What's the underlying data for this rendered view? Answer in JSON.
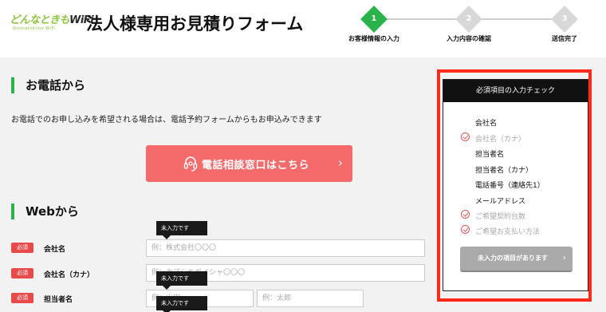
{
  "header": {
    "logo_main": "どんなときもWiFi",
    "logo_sub": "Donnatokimo WiFi",
    "title": "法人様専用お見積りフォーム",
    "steps": [
      {
        "num": "1",
        "label": "お客様情報の入力",
        "active": true
      },
      {
        "num": "2",
        "label": "入力内容の確認",
        "active": false
      },
      {
        "num": "3",
        "label": "送信完了",
        "active": false
      }
    ]
  },
  "phone_section": {
    "heading": "お電話から",
    "description": "お電話でのお申し込みを希望される場合は、電話予約フォームからもお申込みできます",
    "button_label": "電話相談窓口はこちら",
    "button_chevron": "›"
  },
  "web_section": {
    "heading": "Webから",
    "required_badge": "必須",
    "tooltip": "未入力です",
    "fields": [
      {
        "label": "会社名",
        "placeholder": "例：株式会社〇〇〇"
      },
      {
        "label": "会社名（カナ）",
        "placeholder": "例：カブシキガイシャ〇〇〇"
      },
      {
        "label": "担当者名",
        "placeholder_last": "例：山田",
        "placeholder_first": "例：太郎"
      }
    ]
  },
  "checklist": {
    "header": "必須項目の入力チェック",
    "items": [
      {
        "label": "会社名",
        "done": false
      },
      {
        "label": "会社名（カナ）",
        "done": true
      },
      {
        "label": "担当者名",
        "done": false
      },
      {
        "label": "担当者名（カナ）",
        "done": false
      },
      {
        "label": "電話番号（連絡先1）",
        "done": false
      },
      {
        "label": "メールアドレス",
        "done": false
      },
      {
        "label": "ご希望契約台数",
        "done": true
      },
      {
        "label": "ご希望お支払い方法",
        "done": true
      }
    ],
    "button_label": "未入力の項目があります",
    "button_chevron": "›"
  },
  "colors": {
    "brand_green": "#8cc63f",
    "accent_green": "#29b34a",
    "phone_button": "#f56a6a",
    "required_red": "#e84a4a",
    "highlight_border": "#ff2a1a"
  }
}
